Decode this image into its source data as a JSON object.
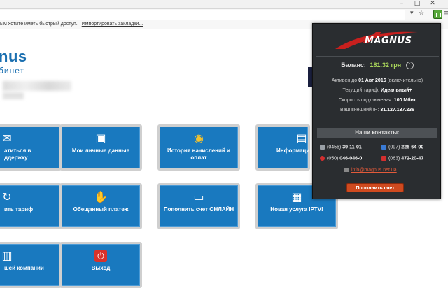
{
  "browser": {
    "bookmarks_text": "ым хотите иметь быстрый доступ.",
    "bookmarks_link": "Импортировать закладки..."
  },
  "page": {
    "brand": "nus",
    "brand_sub": "бинет",
    "tiles": [
      {
        "label": "атиться в\nддержку",
        "icon": "mail-icon"
      },
      {
        "label": "Мои личные данные",
        "icon": "profile-icon"
      },
      {
        "label": "История начислений и оплат",
        "icon": "coins-icon"
      },
      {
        "label": "Информаци",
        "icon": "document-icon"
      },
      {
        "label": "ить тариф",
        "icon": "refresh-icon"
      },
      {
        "label": "Обещанный платеж",
        "icon": "handshake-icon"
      },
      {
        "label": "Пополнить счет ОНЛАЙН",
        "icon": "card-icon"
      },
      {
        "label": "Новая услуга IPTV!",
        "icon": "tv-icon"
      },
      {
        "label": "шей компании",
        "icon": "news-icon"
      },
      {
        "label": "Выход",
        "icon": "power-icon"
      }
    ]
  },
  "popup": {
    "logo": "MAGNUS",
    "balance_label": "Баланс:",
    "balance_value": "181.32 грн",
    "active_label": "Активен до",
    "active_value": "01 Авг 2016",
    "active_note": "(включительно)",
    "tariff_label": "Текущий тариф:",
    "tariff_value": "Идеальный+",
    "speed_label": "Скорость подключения:",
    "speed_value": "100 Мбит",
    "ip_label": "Ваш внешний IP:",
    "ip_value": "31.127.137.236",
    "contacts_title": "Наши контакты:",
    "phones": [
      {
        "code": "(0456)",
        "number": "39-11-01",
        "color": "#9aa0a6"
      },
      {
        "code": "(097)",
        "number": "226-64-00",
        "color": "#3a7bd5"
      },
      {
        "code": "(050)",
        "number": "046-046-0",
        "color": "#d32f2f"
      },
      {
        "code": "(063)",
        "number": "472-20-47",
        "color": "#d32f2f"
      }
    ],
    "email": "info@magnus.net.ua",
    "pay_button": "Пополнить счет"
  }
}
